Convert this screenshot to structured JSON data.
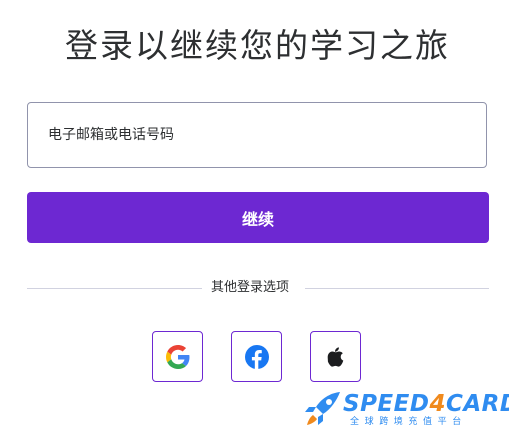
{
  "page": {
    "title": "登录以继续您的学习之旅"
  },
  "email_field": {
    "placeholder": "电子邮箱或电话号码",
    "value": ""
  },
  "continue_button": {
    "label": "继续",
    "color": "#6d28d2"
  },
  "divider": {
    "label": "其他登录选项"
  },
  "social_buttons": [
    {
      "name": "google",
      "icon": "google-icon"
    },
    {
      "name": "facebook",
      "icon": "facebook-icon"
    },
    {
      "name": "apple",
      "icon": "apple-icon"
    }
  ],
  "watermark": {
    "brand_part1": "SPEED",
    "brand_part2": "4",
    "brand_part3": "CARD",
    "tagline": "全球跨境充值平台",
    "icon": "rocket-icon"
  }
}
